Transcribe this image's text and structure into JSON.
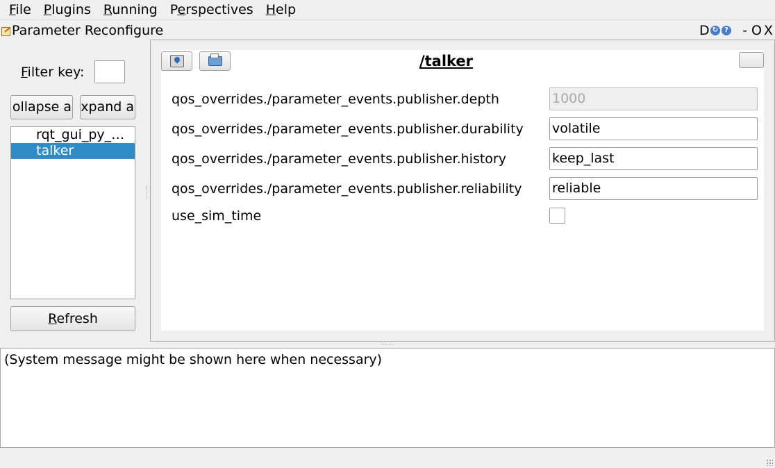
{
  "menubar": {
    "items": [
      {
        "mnemonic": "F",
        "rest": "ile"
      },
      {
        "mnemonic": "P",
        "rest": "lugins"
      },
      {
        "mnemonic": "R",
        "rest": "unning"
      },
      {
        "pre": "P",
        "mnemonic": "e",
        "rest": "rspectives"
      },
      {
        "mnemonic": "H",
        "rest": "elp"
      }
    ]
  },
  "plugin": {
    "title": "Parameter Reconfigure",
    "controls": {
      "dock": "D",
      "reload": "↻",
      "help": "?",
      "minimize": "-",
      "maximize": "O",
      "close": "X"
    }
  },
  "left": {
    "filter_mnemonic": "F",
    "filter_rest": "ilter key:",
    "filter_value": "",
    "collapse_label": "ollapse a",
    "expand_label": "xpand a",
    "nodes": [
      "rqt_gui_py_…",
      "talker"
    ],
    "selected_node": "talker",
    "refresh_mnemonic": "R",
    "refresh_rest": "efresh"
  },
  "node_editor": {
    "title": "/talker",
    "params": [
      {
        "name": "qos_overrides./parameter_events.publisher.depth",
        "value": "1000",
        "disabled": true
      },
      {
        "name": "qos_overrides./parameter_events.publisher.durability",
        "value": "volatile"
      },
      {
        "name": "qos_overrides./parameter_events.publisher.history",
        "value": "keep_last"
      },
      {
        "name": "qos_overrides./parameter_events.publisher.reliability",
        "value": "reliable"
      },
      {
        "name": "use_sim_time",
        "value": false,
        "type": "bool"
      }
    ]
  },
  "messages": {
    "text": "(System message might be shown here when necessary)"
  },
  "icons": {
    "plugin": "edit-pencil-icon",
    "save": "save-download-icon",
    "open": "folder-open-icon"
  }
}
